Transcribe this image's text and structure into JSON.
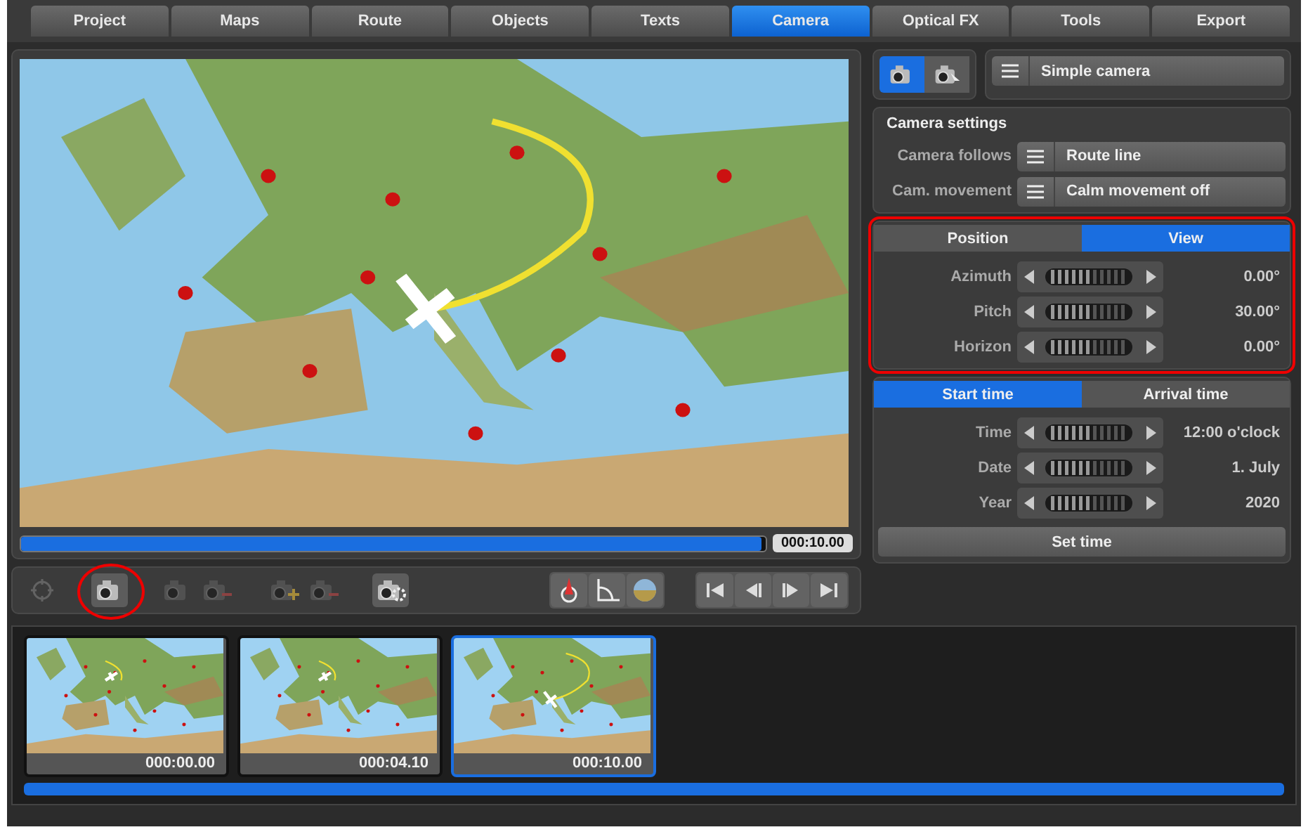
{
  "tabs": [
    {
      "label": "Project",
      "selected": false
    },
    {
      "label": "Maps",
      "selected": false
    },
    {
      "label": "Route",
      "selected": false
    },
    {
      "label": "Objects",
      "selected": false
    },
    {
      "label": "Texts",
      "selected": false
    },
    {
      "label": "Camera",
      "selected": true
    },
    {
      "label": "Optical FX",
      "selected": false
    },
    {
      "label": "Tools",
      "selected": false
    },
    {
      "label": "Export",
      "selected": false
    }
  ],
  "preview": {
    "timeline": {
      "level": 0.995,
      "time": "000:10.00"
    }
  },
  "toolbar": [
    {
      "kind": "crosshair",
      "disabled": true,
      "highlighted": false
    },
    {
      "kind": "camera",
      "disabled": false,
      "highlighted": true
    },
    {
      "kind": "camera-back",
      "disabled": true,
      "highlighted": false
    },
    {
      "kind": "camera-forward",
      "disabled": true,
      "highlighted": false
    },
    {
      "kind": "camera-plus",
      "disabled": true,
      "highlighted": false
    },
    {
      "kind": "camera-minus",
      "disabled": true,
      "highlighted": false
    },
    {
      "kind": "camera-gear",
      "disabled": false,
      "highlighted": false
    },
    {
      "kind": "compass",
      "disabled": false,
      "highlighted": false
    },
    {
      "kind": "angle",
      "disabled": false,
      "highlighted": false
    },
    {
      "kind": "globe",
      "disabled": false,
      "highlighted": false
    },
    {
      "kind": "first",
      "disabled": false,
      "highlighted": false
    },
    {
      "kind": "prev",
      "disabled": false,
      "highlighted": false
    },
    {
      "kind": "next",
      "disabled": false,
      "highlighted": false
    },
    {
      "kind": "last",
      "disabled": false,
      "highlighted": false
    }
  ],
  "camera_mode": {
    "buttons": [
      {
        "kind": "camera",
        "selected": true
      },
      {
        "kind": "camera-pointer",
        "selected": false
      }
    ],
    "preset": "Simple camera"
  },
  "camera_settings": {
    "title": "Camera settings",
    "rows": [
      {
        "label": "Camera follows",
        "value": "Route line"
      },
      {
        "label": "Cam. movement",
        "value": "Calm movement off"
      }
    ]
  },
  "view_panel": {
    "highlighted": true,
    "tabs": [
      {
        "label": "Position",
        "selected": false
      },
      {
        "label": "View",
        "selected": true
      }
    ],
    "rows": [
      {
        "label": "Azimuth",
        "reading": "0.00°"
      },
      {
        "label": "Pitch",
        "reading": "30.00°"
      },
      {
        "label": "Horizon",
        "reading": "0.00°"
      }
    ]
  },
  "time_panel": {
    "tabs": [
      {
        "label": "Start time",
        "selected": true
      },
      {
        "label": "Arrival time",
        "selected": false
      }
    ],
    "rows": [
      {
        "label": "Time",
        "reading": "12:00 o'clock"
      },
      {
        "label": "Date",
        "reading": "1. July"
      },
      {
        "label": "Year",
        "reading": "2020"
      }
    ],
    "button": "Set time"
  },
  "filmstrip": {
    "keyframes": [
      {
        "time": "000:00.00",
        "selected": false
      },
      {
        "time": "000:04.10",
        "selected": false
      },
      {
        "time": "000:10.00",
        "selected": true
      }
    ]
  }
}
